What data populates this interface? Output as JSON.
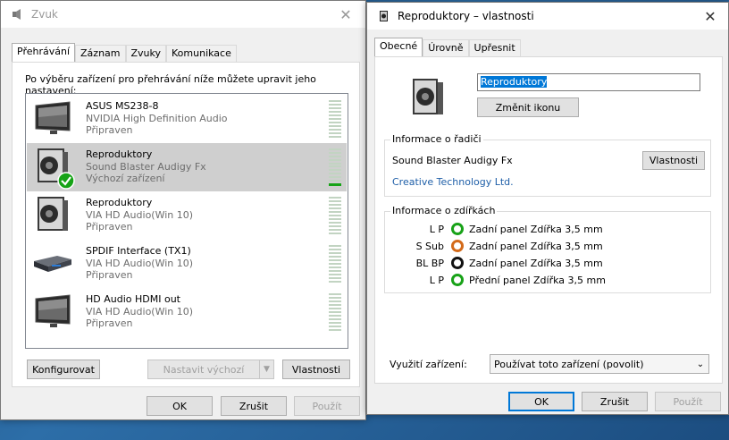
{
  "sound_window": {
    "title": "Zvuk",
    "tabs": [
      "Přehrávání",
      "Záznam",
      "Zvuky",
      "Komunikace"
    ],
    "instruction": "Po výběru zařízení pro přehrávání níže můžete upravit jeho nastavení:",
    "devices": [
      {
        "name": "ASUS MS238-8",
        "driver": "NVIDIA High Definition Audio",
        "status": "Připraven",
        "icon": "monitor-icon",
        "selected": false
      },
      {
        "name": "Reproduktory",
        "driver": "Sound Blaster Audigy Fx",
        "status": "Výchozí zařízení",
        "icon": "speaker-icon",
        "selected": true
      },
      {
        "name": "Reproduktory",
        "driver": "VIA HD Audio(Win 10)",
        "status": "Připraven",
        "icon": "speaker-icon",
        "selected": false
      },
      {
        "name": "SPDIF Interface (TX1)",
        "driver": "VIA HD Audio(Win 10)",
        "status": "Připraven",
        "icon": "spdif-device-icon",
        "selected": false
      },
      {
        "name": "HD Audio HDMI out",
        "driver": "VIA HD Audio(Win 10)",
        "status": "Připraven",
        "icon": "monitor-icon",
        "selected": false
      }
    ],
    "configure_label": "Konfigurovat",
    "set_default_label": "Nastavit výchozí",
    "properties_label": "Vlastnosti",
    "ok_label": "OK",
    "cancel_label": "Zrušit",
    "apply_label": "Použít"
  },
  "props_window": {
    "title": "Reproduktory – vlastnosti",
    "tabs": [
      "Obecné",
      "Úrovně",
      "Upřesnit"
    ],
    "device_name_value": "Reproduktory",
    "change_icon_label": "Změnit ikonu",
    "controller_section": "Informace o řadiči",
    "controller_name": "Sound Blaster Audigy Fx",
    "controller_properties_label": "Vlastnosti",
    "manufacturer": "Creative Technology Ltd.",
    "jacks_section": "Informace o zdířkách",
    "jacks": [
      {
        "channel": "L P",
        "color": "#18a218",
        "description": "Zadní panel Zdířka 3,5 mm"
      },
      {
        "channel": "S Sub",
        "color": "#d36a1a",
        "description": "Zadní panel Zdířka 3,5 mm"
      },
      {
        "channel": "BL BP",
        "color": "#111111",
        "description": "Zadní panel Zdířka 3,5 mm"
      },
      {
        "channel": "L P",
        "color": "#18a218",
        "description": "Přední panel Zdířka 3,5 mm"
      }
    ],
    "device_usage_label": "Využití zařízení:",
    "device_usage_value": "Používat toto zařízení (povolit)",
    "ok_label": "OK",
    "cancel_label": "Zrušit",
    "apply_label": "Použít"
  }
}
